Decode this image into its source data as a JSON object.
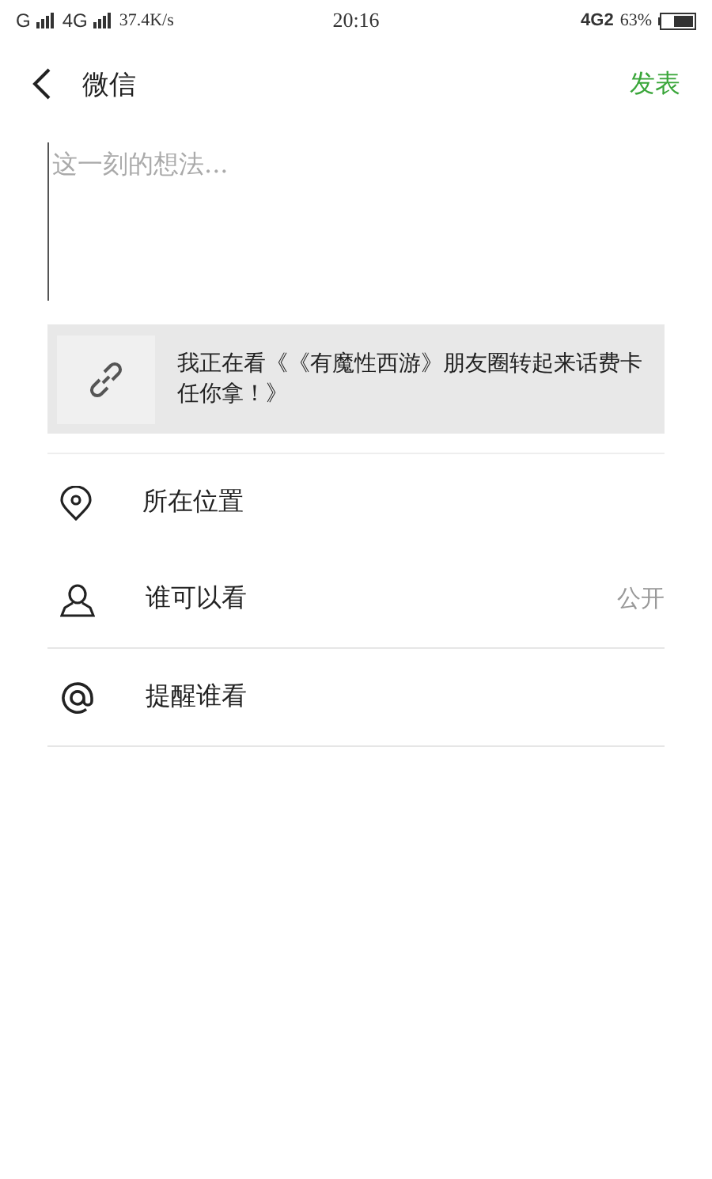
{
  "status_bar": {
    "carrier_1": "G",
    "carrier_2": "4G",
    "speed": "37.4K/s",
    "time": "20:16",
    "network": "4G2",
    "battery": "63%"
  },
  "header": {
    "title": "微信",
    "action": "发表"
  },
  "compose": {
    "placeholder": "这一刻的想法..."
  },
  "link_card": {
    "text": "我正在看《《有魔性西游》朋友圈转起来话费卡任你拿！》"
  },
  "options": [
    {
      "kind": "location",
      "label": "所在位置",
      "divider": false
    },
    {
      "kind": "person",
      "label": "谁可以看",
      "value": "公开",
      "divider": true
    },
    {
      "kind": "at",
      "label": "提醒谁看",
      "divider": true
    }
  ]
}
